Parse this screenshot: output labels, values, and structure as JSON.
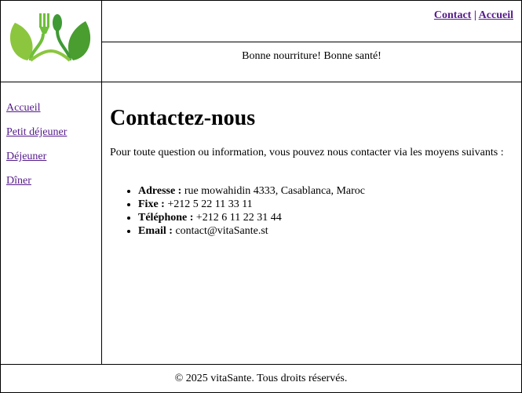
{
  "header": {
    "logo_name": "leaf-fork-spoon-logo",
    "nav_links": [
      "Contact",
      "Accueil"
    ],
    "separator": "|",
    "slogan": "Bonne nourriture! Bonne santé!"
  },
  "sidebar": {
    "items": [
      "Accueil",
      "Petit déjeuner",
      "Déjeuner",
      "Dîner"
    ]
  },
  "main": {
    "title": "Contactez-nous",
    "intro": "Pour toute question ou information, vous pouvez nous contacter via les moyens suivants :",
    "contacts": [
      {
        "label": "Adresse :",
        "value": " rue mowahidin 4333, Casablanca, Maroc"
      },
      {
        "label": "Fixe :",
        "value": " +212 5 22 11 33 11"
      },
      {
        "label": "Téléphone :",
        "value": " +212 6 11 22 31 44"
      },
      {
        "label": "Email :",
        "value": " contact@vitaSante.st"
      }
    ]
  },
  "footer": {
    "text": "© 2025 vitaSante. Tous droits réservés."
  },
  "colors": {
    "link": "#551a8b",
    "leaf_light": "#8cc63f",
    "leaf_dark": "#4a9d2f"
  }
}
